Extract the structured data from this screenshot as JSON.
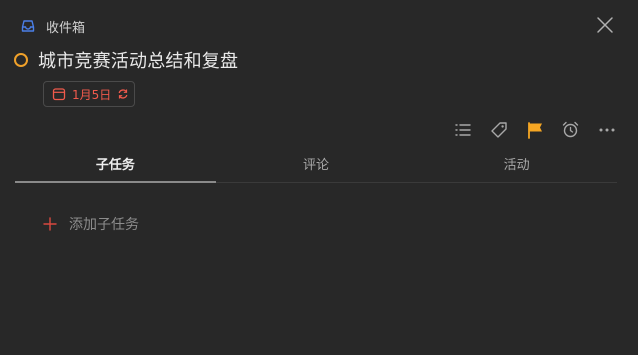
{
  "header": {
    "list_name": "收件箱",
    "list_icon": "inbox-icon",
    "close_icon": "close-icon"
  },
  "task": {
    "title": "城市竞赛活动总结和复盘",
    "status_color": "#f0a12a"
  },
  "date_chip": {
    "label": "1月5日",
    "color": "#f05a4c",
    "repeat_icon": "repeat-icon",
    "calendar_icon": "calendar-icon"
  },
  "toolbar": {
    "items": [
      {
        "icon": "list-icon"
      },
      {
        "icon": "tag-icon"
      },
      {
        "icon": "flag-icon",
        "color": "#f5a623"
      },
      {
        "icon": "alarm-clock-icon"
      },
      {
        "icon": "more-icon"
      }
    ]
  },
  "tabs": [
    {
      "label": "子任务",
      "active": true
    },
    {
      "label": "评论",
      "active": false
    },
    {
      "label": "活动",
      "active": false
    }
  ],
  "subtasks": {
    "add_label": "添加子任务",
    "add_icon_color": "#d9493f"
  }
}
